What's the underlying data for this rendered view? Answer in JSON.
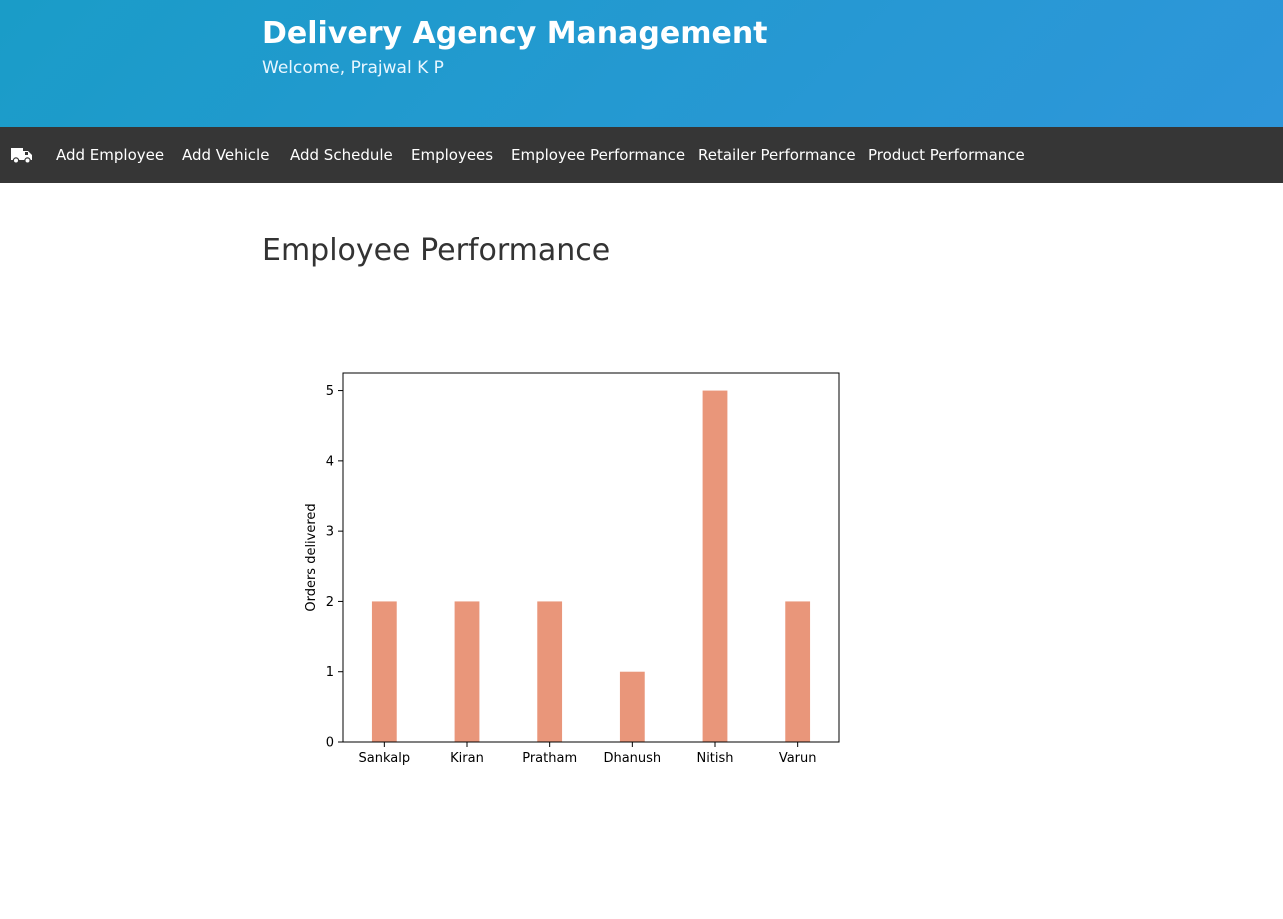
{
  "header": {
    "title": "Delivery Agency Management",
    "welcome": "Welcome, Prajwal K P"
  },
  "nav": {
    "logo_icon": "truck-icon",
    "items": [
      "Add Employee",
      "Add Vehicle",
      "Add Schedule",
      "Employees",
      "Employee Performance",
      "Retailer Performance",
      "Product Performance"
    ]
  },
  "main": {
    "heading": "Employee Performance"
  },
  "colors": {
    "header_start": "#1a9cc8",
    "header_end": "#2e96da",
    "navbar": "#363636",
    "bar": "#e9967a"
  },
  "chart_data": {
    "type": "bar",
    "categories": [
      "Sankalp",
      "Kiran",
      "Pratham",
      "Dhanush",
      "Nitish",
      "Varun"
    ],
    "values": [
      2,
      2,
      2,
      1,
      5,
      2
    ],
    "title": "",
    "xlabel": "",
    "ylabel": "Orders delivered",
    "ylim": [
      0,
      5.25
    ],
    "yticks": [
      0,
      1,
      2,
      3,
      4,
      5
    ],
    "grid": false,
    "legend": "none"
  }
}
